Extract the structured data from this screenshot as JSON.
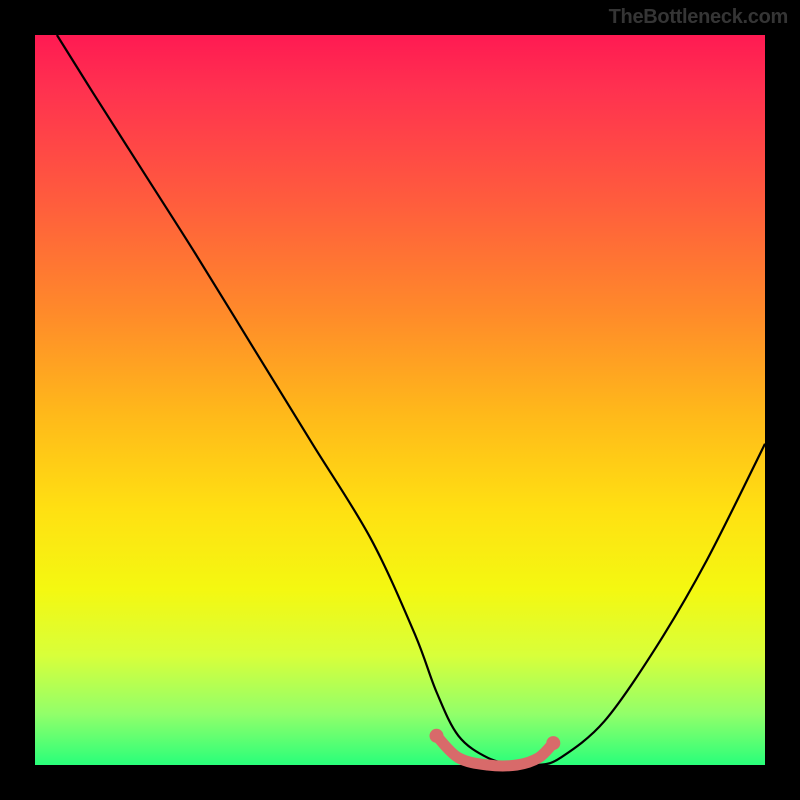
{
  "attribution": "TheBottleneck.com",
  "chart_data": {
    "type": "line",
    "title": "",
    "xlabel": "",
    "ylabel": "",
    "xlim": [
      0,
      100
    ],
    "ylim": [
      0,
      100
    ],
    "series": [
      {
        "name": "bottleneck-curve",
        "x": [
          3,
          8,
          15,
          22,
          30,
          38,
          46,
          52,
          55,
          58,
          62,
          66,
          69,
          72,
          78,
          85,
          92,
          100
        ],
        "y": [
          100,
          92,
          81,
          70,
          57,
          44,
          31,
          18,
          10,
          4,
          1,
          0,
          0,
          1,
          6,
          16,
          28,
          44
        ],
        "color": "#000000"
      },
      {
        "name": "optimal-zone",
        "x": [
          55,
          58,
          62,
          66,
          69,
          71
        ],
        "y": [
          4,
          1,
          0,
          0,
          1,
          3
        ],
        "color": "#d86a6a"
      }
    ],
    "gradient_stops": [
      {
        "pos": 0,
        "color": "#ff1a52"
      },
      {
        "pos": 7,
        "color": "#ff3050"
      },
      {
        "pos": 22,
        "color": "#ff5a3e"
      },
      {
        "pos": 38,
        "color": "#ff8a2a"
      },
      {
        "pos": 52,
        "color": "#ffb91a"
      },
      {
        "pos": 65,
        "color": "#ffe012"
      },
      {
        "pos": 76,
        "color": "#f4f811"
      },
      {
        "pos": 85,
        "color": "#d8ff3a"
      },
      {
        "pos": 93,
        "color": "#92ff6a"
      },
      {
        "pos": 100,
        "color": "#29ff7a"
      }
    ]
  }
}
